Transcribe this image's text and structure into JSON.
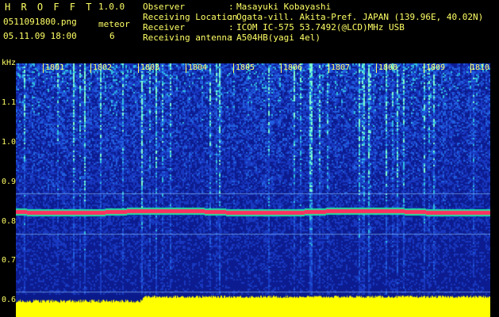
{
  "app": {
    "title": "H R O F F T",
    "version": "1.0.0"
  },
  "file": {
    "name": "0511091800.png",
    "datetime": "05.11.09 18:00"
  },
  "meteor": {
    "label": "meteor",
    "count": "6"
  },
  "info": [
    {
      "key": "Observer",
      "value": "Masayuki Kobayashi"
    },
    {
      "key": "Receiving Location",
      "value": "Ogata-vill. Akita-Pref. JAPAN (139.96E, 40.02N)"
    },
    {
      "key": "Receiver",
      "value": "ICOM IC-575 53.7492(@LCD)MHz USB"
    },
    {
      "key": "Receiving antenna",
      "value": "A504HB(yagi 4el)"
    }
  ],
  "axis": {
    "unit": "kHz",
    "y_ticks": [
      "1.1",
      "1.0",
      "0.9",
      "0.8",
      "0.7",
      "0.6"
    ],
    "x_ticks": [
      "1801",
      "1802",
      "1803",
      "1804",
      "1805",
      "1806",
      "1807",
      "1808",
      "1809",
      "1810"
    ]
  },
  "colors": {
    "background": "#000000",
    "text": "#ffff66",
    "spectrum": "#1a30c0",
    "signal": "#ff2a4a",
    "level": "#ffff00"
  }
}
